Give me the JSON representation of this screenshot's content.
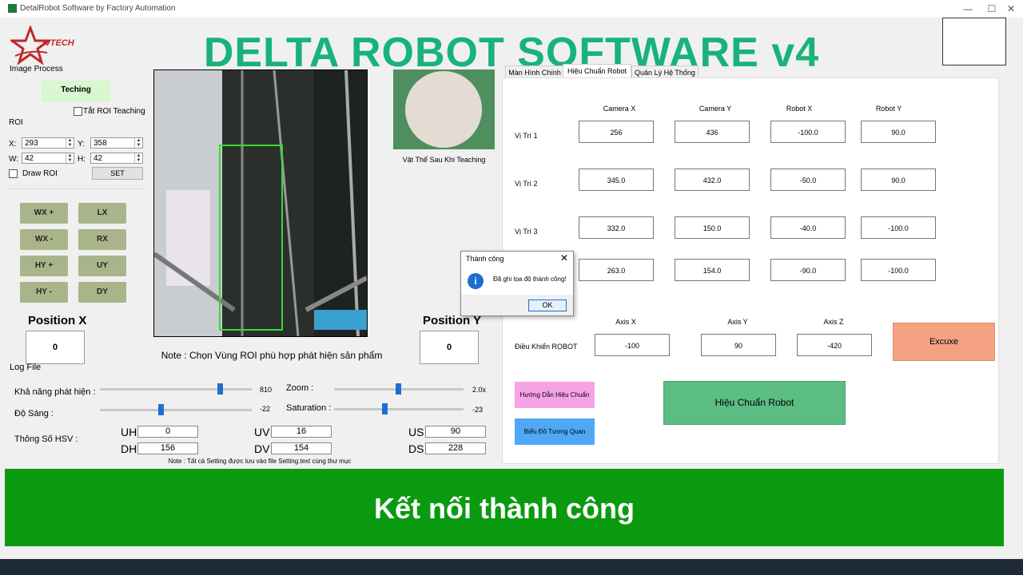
{
  "window": {
    "title": "DetalRobot Software by Factory Automation",
    "minimize": "—",
    "maximize": "☐",
    "close": "✕"
  },
  "header": {
    "title": "DELTA ROBOT SOFTWARE v4",
    "logo_text": "tvTECH"
  },
  "image_process": {
    "title": "Image Process",
    "teaching_label": "Teching",
    "roi_checkbox_label": "Tắt ROI Teaching",
    "roi_title": "ROI",
    "x_label": "X:",
    "x_value": "293",
    "y_label": "Y:",
    "y_value": "358",
    "w_label": "W:",
    "w_value": "42",
    "h_label": "H:",
    "h_value": "42",
    "draw_roi_label": "Draw ROI",
    "set_label": "SET",
    "jog_buttons": [
      "WX +",
      "LX",
      "WX -",
      "RX",
      "HY +",
      "UY",
      "HY -",
      "DY"
    ]
  },
  "preview": {
    "caption": "Vật Thể Sau Khi Teaching"
  },
  "note_roi": "Note : Chọn Vùng ROI phù hợp phát hiện sản phẩm",
  "position_x": {
    "label": "Position X",
    "value": "0"
  },
  "position_y": {
    "label": "Position Y",
    "value": "0"
  },
  "log": {
    "title": "Log File",
    "detect_label": "Khả năng phát hiện :",
    "detect_value": "810",
    "detect_level": 0.8,
    "brightness_label": "Độ Sáng :",
    "brightness_value": "-22",
    "brightness_level": 0.36,
    "zoom_label": "Zoom :",
    "zoom_value": "2.0x",
    "zoom_level": 0.5,
    "saturation_label": "Saturation :",
    "saturation_value": "-23",
    "saturation_level": 0.39,
    "hsv_label": "Thông Số HSV :",
    "uh_label": "UH",
    "uh_value": "0",
    "dh_label": "DH",
    "dh_value": "156",
    "uv_label": "UV",
    "uv_value": "16",
    "dv_label": "DV",
    "dv_value": "154",
    "us_label": "US",
    "us_value": "90",
    "ds_label": "DS",
    "ds_value": "228",
    "note": "Note : Tất cả Setting được lưu vào file Setting.text cùng thư mục"
  },
  "tabs": [
    "Màn Hình Chính",
    "Hiệu Chuẩn Robot",
    "Quản Lý Hệ Thống"
  ],
  "calibration": {
    "headers": [
      "Camera X",
      "Camera Y",
      "Robot X",
      "Robot Y"
    ],
    "rows": [
      {
        "label": "Vị Trí 1",
        "values": [
          "256",
          "436",
          "-100.0",
          "90.0"
        ]
      },
      {
        "label": "Vị Trí 2",
        "values": [
          "345.0",
          "432.0",
          "-50.0",
          "90.0"
        ]
      },
      {
        "label": "Vị Trí 3",
        "values": [
          "332.0",
          "150.0",
          "-40.0",
          "-100.0"
        ]
      },
      {
        "label": "",
        "values": [
          "263.0",
          "154.0",
          "-90.0",
          "-100.0"
        ]
      }
    ],
    "axis_headers": [
      "Axis X",
      "Axis Y",
      "Axis Z"
    ],
    "control_label": "Điều Khiển ROBOT",
    "axis_values": [
      "-100",
      "90",
      "-420"
    ],
    "execute_label": "Excuxe",
    "guide_label": "Hướng Dẫn Hiệu Chuẩn",
    "chart_label": "Biểu Đồ Tương Quan",
    "calibrate_label": "Hiệu Chuẩn Robot"
  },
  "dialog": {
    "title": "Thành công",
    "message": "Đã ghi tọa độ thành công!",
    "ok": "OK",
    "close": "✕",
    "icon": "i"
  },
  "status_banner": "Kết nối thành công"
}
